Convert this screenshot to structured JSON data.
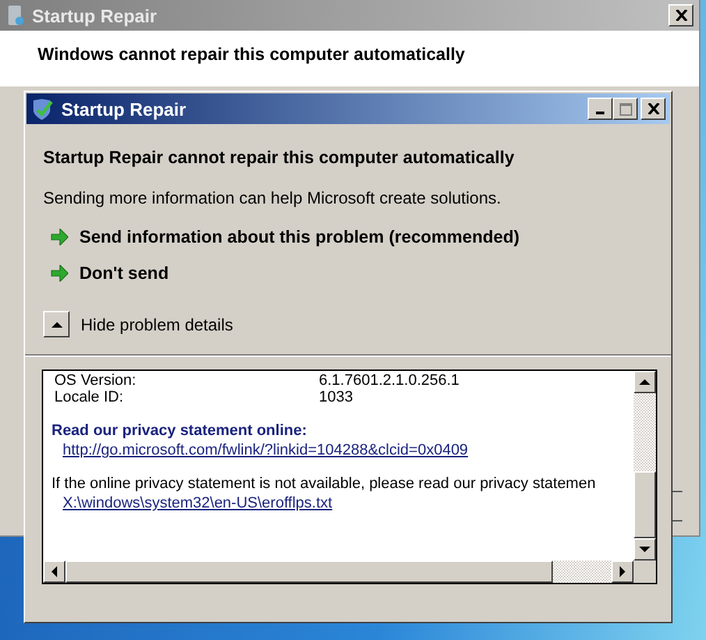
{
  "background_window": {
    "title": "Startup Repair",
    "heading": "Windows cannot repair this computer automatically"
  },
  "dialog": {
    "title": "Startup Repair",
    "heading": "Startup Repair cannot repair this computer automatically",
    "description": "Sending more information can help Microsoft create solutions.",
    "options": [
      {
        "label": "Send information about this problem (recommended)"
      },
      {
        "label": "Don't send"
      }
    ],
    "details_toggle": {
      "label": "Hide problem details",
      "expanded": true
    },
    "details": {
      "rows": [
        {
          "label": "OS Version:",
          "value": "6.1.7601.2.1.0.256.1"
        },
        {
          "label": "Locale ID:",
          "value": "1033"
        }
      ],
      "privacy_heading": "Read our privacy statement online:",
      "privacy_link": "http://go.microsoft.com/fwlink/?linkid=104288&clcid=0x0409",
      "offline_note": "If the online privacy statement is not available, please read our privacy statemen",
      "offline_link": "X:\\windows\\system32\\en-US\\erofflps.txt"
    }
  }
}
